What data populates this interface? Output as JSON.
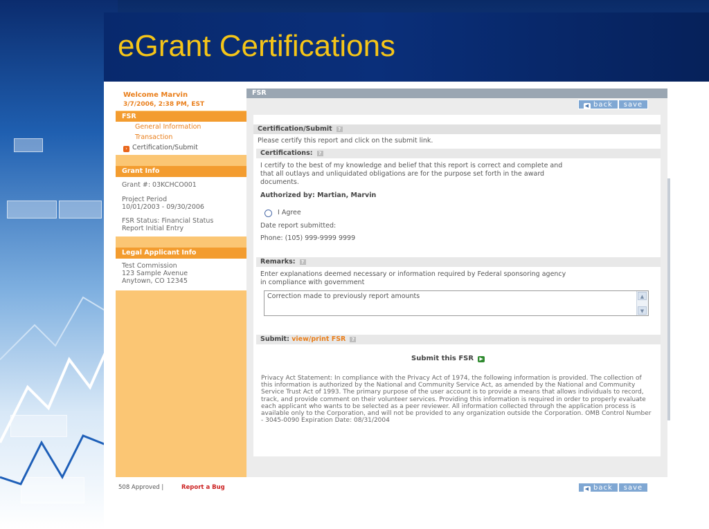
{
  "slide": {
    "title": "eGrant Certifications"
  },
  "sidebar": {
    "welcome": "Welcome Marvin",
    "datetime": "3/7/2006, 2:38 PM, EST",
    "fsr_header": "FSR",
    "nav": [
      {
        "label": "General Information"
      },
      {
        "label": "Transaction"
      },
      {
        "label": "Certification/Submit"
      }
    ],
    "grant_header": "Grant Info",
    "grant_number": "Grant #: 03KCHCO001",
    "project_period_label": "Project Period",
    "project_period_value": "10/01/2003 - 09/30/2006",
    "status_line1": "FSR Status: Financial Status",
    "status_line2": "Report Initial Entry",
    "legal_header": "Legal Applicant Info",
    "legal_line1": "Test Commission",
    "legal_line2": "123 Sample Avenue",
    "legal_line3": "Anytown, CO 12345"
  },
  "main": {
    "topbar_title": "FSR",
    "back_label": "back",
    "save_label": "save",
    "section_title": "Certification/Submit",
    "instruction": "Please certify this report and click on the submit link.",
    "certifications_title": "Certifications:",
    "cert_text_1": "I certify to the best of my knowledge and belief that this report is correct and complete and",
    "cert_text_2": "that all outlays and unliquidated obligations are for the purpose set forth in the award",
    "cert_text_3": "documents.",
    "authorized_by": "Authorized by: Martian, Marvin",
    "agree_label": "I Agree",
    "date_submitted": "Date report submitted:",
    "phone": "Phone: (105) 999-9999 9999",
    "remarks_title": "Remarks:",
    "remarks_text_1": "Enter explanations deemed necessary or information required by Federal sponsoring agency",
    "remarks_text_2": "in compliance with government",
    "remarks_value": "Correction made to previously report amounts",
    "submit_title": "Submit:",
    "submit_link": "view/print FSR",
    "submit_fsr": "Submit this FSR",
    "privacy_text": "Privacy Act Statement: In compliance with the Privacy Act of 1974, the following information is provided. The collection of this information is authorized by the National and Community Service Act, as amended by the National and Community Service Trust Act of 1993. The primary purpose of the user account is to provide a means that allows individuals to record, track, and provide comment on their volunteer services. Providing this information is required in order to properly evaluate each applicant who wants to be selected as a peer reviewer. All information collected through the application process is available only to the Corporation, and will not be provided to any organization outside the Corporation. OMB Control Number - 3045-0090 Expiration Date: 08/31/2004"
  },
  "footer": {
    "approved": "508 Approved |",
    "report_bug": "Report a Bug"
  },
  "colors": {
    "title_yellow": "#f5c518",
    "sidebar_orange": "#fbc674",
    "header_orange": "#f39c2f",
    "link_orange": "#e97e1a",
    "button_blue": "#7fa7d3"
  }
}
